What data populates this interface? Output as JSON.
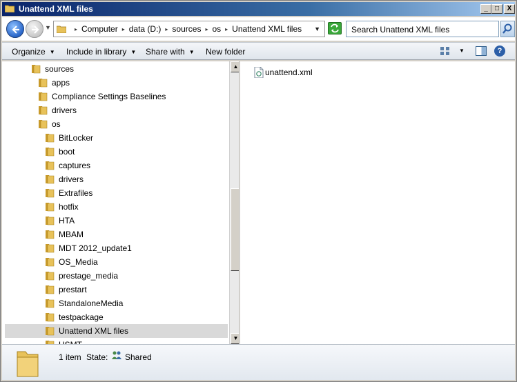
{
  "window": {
    "title": "Unattend XML files",
    "controls": {
      "minimize": "_",
      "maximize": "□",
      "close": "X"
    }
  },
  "address_bar": {
    "crumbs": [
      "Computer",
      "data (D:)",
      "sources",
      "os",
      "Unattend XML files"
    ],
    "search_placeholder": "Search Unattend XML files"
  },
  "toolbar": {
    "organize": "Organize",
    "include_in_library": "Include in library",
    "share_with": "Share with",
    "new_folder": "New folder"
  },
  "navigation": {
    "items": [
      {
        "label": "sources",
        "level": 0
      },
      {
        "label": "apps",
        "level": 1
      },
      {
        "label": "Compliance Settings Baselines",
        "level": 1
      },
      {
        "label": "drivers",
        "level": 1
      },
      {
        "label": "os",
        "level": 1
      },
      {
        "label": "BitLocker",
        "level": 2
      },
      {
        "label": "boot",
        "level": 2
      },
      {
        "label": "captures",
        "level": 2
      },
      {
        "label": "drivers",
        "level": 2
      },
      {
        "label": "Extrafiles",
        "level": 2
      },
      {
        "label": "hotfix",
        "level": 2
      },
      {
        "label": "HTA",
        "level": 2
      },
      {
        "label": "MBAM",
        "level": 2
      },
      {
        "label": "MDT 2012_update1",
        "level": 2
      },
      {
        "label": "OS_Media",
        "level": 2
      },
      {
        "label": "prestage_media",
        "level": 2
      },
      {
        "label": "prestart",
        "level": 2
      },
      {
        "label": "StandaloneMedia",
        "level": 2
      },
      {
        "label": "testpackage",
        "level": 2
      },
      {
        "label": "Unattend XML files",
        "level": 2,
        "selected": true
      },
      {
        "label": "USMT",
        "level": 2
      }
    ]
  },
  "files": [
    {
      "name": "unattend.xml",
      "icon": "xml-file-icon"
    }
  ],
  "details": {
    "count": "1 item",
    "state_label": "State:",
    "state_value": "Shared"
  },
  "colors": {
    "title_bar_start": "#0a246a",
    "title_bar_end": "#a6caf0",
    "folder": "#e8c25a",
    "selection": "#d9d9d9"
  }
}
